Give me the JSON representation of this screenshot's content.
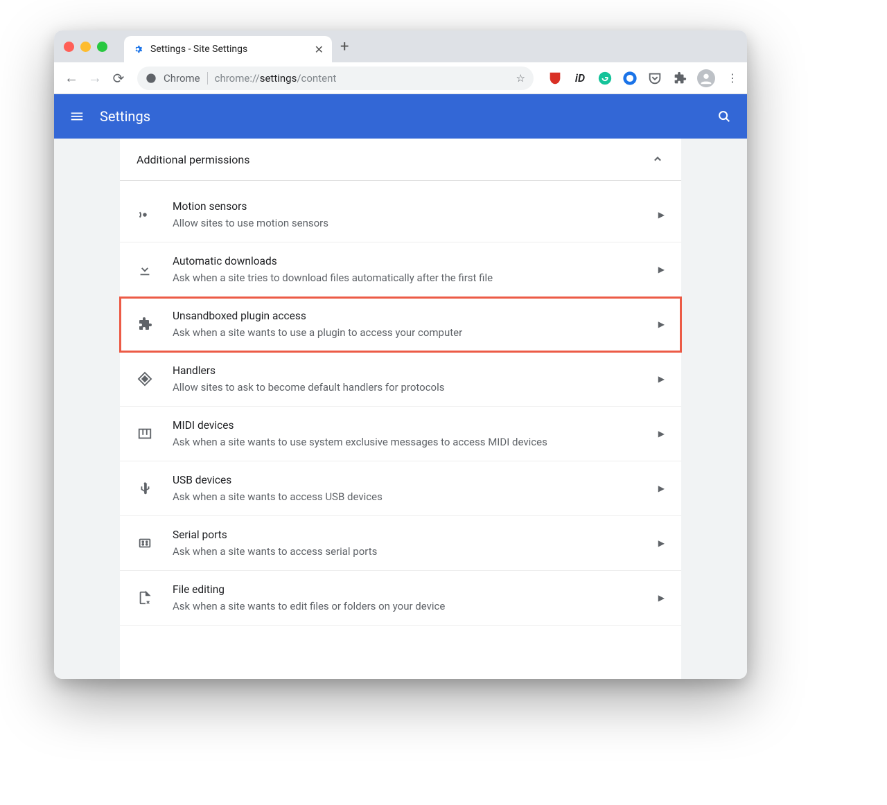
{
  "window": {
    "tab_title": "Settings - Site Settings"
  },
  "omnibox": {
    "origin_label": "Chrome",
    "url_prefix": "chrome://",
    "url_path_strong": "settings",
    "url_path_rest": "/content"
  },
  "header": {
    "title": "Settings"
  },
  "section": {
    "title": "Additional permissions"
  },
  "permissions": [
    {
      "icon": "motion-sensors-icon",
      "title": "Motion sensors",
      "subtitle": "Allow sites to use motion sensors"
    },
    {
      "icon": "download-icon",
      "title": "Automatic downloads",
      "subtitle": "Ask when a site tries to download files automatically after the first file"
    },
    {
      "icon": "plugin-icon",
      "title": "Unsandboxed plugin access",
      "subtitle": "Ask when a site wants to use a plugin to access your computer",
      "highlight": true
    },
    {
      "icon": "handlers-icon",
      "title": "Handlers",
      "subtitle": "Allow sites to ask to become default handlers for protocols"
    },
    {
      "icon": "midi-icon",
      "title": "MIDI devices",
      "subtitle": "Ask when a site wants to use system exclusive messages to access MIDI devices"
    },
    {
      "icon": "usb-icon",
      "title": "USB devices",
      "subtitle": "Ask when a site wants to access USB devices"
    },
    {
      "icon": "serial-icon",
      "title": "Serial ports",
      "subtitle": "Ask when a site wants to access serial ports"
    },
    {
      "icon": "file-edit-icon",
      "title": "File editing",
      "subtitle": "Ask when a site wants to edit files or folders on your device"
    }
  ]
}
